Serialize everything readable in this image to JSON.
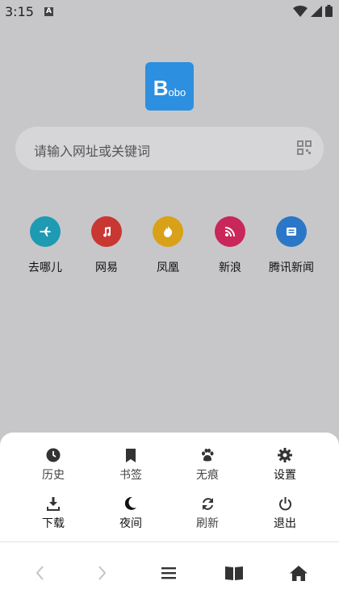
{
  "status_bar": {
    "time": "3:15",
    "notification_badge": "A"
  },
  "logo": {
    "big_letter": "B",
    "rest": "obo"
  },
  "search": {
    "placeholder": "请输入网址或关键词"
  },
  "shortcuts": [
    {
      "label": "去哪儿",
      "icon": "airplane-icon",
      "color": "#1e9bb3"
    },
    {
      "label": "网易",
      "icon": "music-note-icon",
      "color": "#c93732"
    },
    {
      "label": "凤凰",
      "icon": "fire-icon",
      "color": "#d8a117"
    },
    {
      "label": "新浪",
      "icon": "rss-icon",
      "color": "#c9265a"
    },
    {
      "label": "腾讯新闻",
      "icon": "news-icon",
      "color": "#2a77c8"
    }
  ],
  "menu": [
    {
      "label": "历史",
      "icon": "clock-icon"
    },
    {
      "label": "书签",
      "icon": "bookmark-icon"
    },
    {
      "label": "无痕",
      "icon": "paw-icon"
    },
    {
      "label": "设置",
      "icon": "gear-icon"
    },
    {
      "label": "下载",
      "icon": "download-icon"
    },
    {
      "label": "夜间",
      "icon": "moon-icon"
    },
    {
      "label": "刷新",
      "icon": "refresh-icon"
    },
    {
      "label": "退出",
      "icon": "power-icon"
    }
  ],
  "nav": [
    {
      "icon": "back-arrow-icon"
    },
    {
      "icon": "forward-arrow-icon"
    },
    {
      "icon": "menu-icon"
    },
    {
      "icon": "book-icon"
    },
    {
      "icon": "home-icon"
    }
  ]
}
